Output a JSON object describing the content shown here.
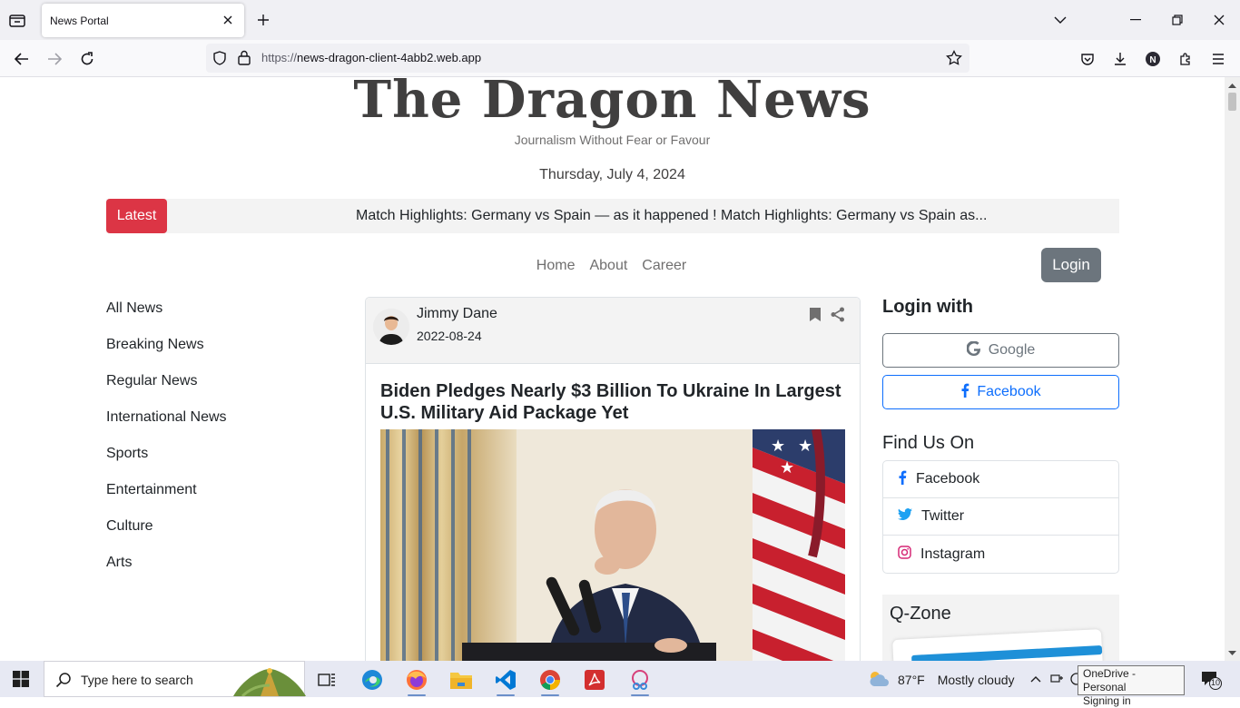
{
  "browser": {
    "tab_title": "News Portal",
    "url_host": "https://news-dragon-client-4abb2.web.app",
    "url_scheme_dim": "https://",
    "url_rest": "news-dragon-client-4abb2.web.app"
  },
  "site": {
    "logo": "The Dragon News",
    "tagline": "Journalism Without Fear or Favour",
    "date": "Thursday, July 4, 2024",
    "latest_label": "Latest",
    "ticker_text": "Match Highlights: Germany vs Spain — as it happened ! Match Highlights: Germany vs Spain as..."
  },
  "nav": {
    "items": [
      "Home",
      "About",
      "Career"
    ],
    "login": "Login"
  },
  "categories": [
    "All News",
    "Breaking News",
    "Regular News",
    "International News",
    "Sports",
    "Entertainment",
    "Culture",
    "Arts"
  ],
  "article": {
    "author": "Jimmy Dane",
    "date": "2022-08-24",
    "title": "Biden Pledges Nearly $3 Billion To Ukraine In Largest U.S. Military Aid Package Yet"
  },
  "sidebar": {
    "login_with": "Login with",
    "google": "Google",
    "facebook": "Facebook",
    "find_us": "Find Us On",
    "socials": [
      "Facebook",
      "Twitter",
      "Instagram"
    ],
    "qzone": "Q-Zone"
  },
  "taskbar": {
    "search_placeholder": "Type here to search",
    "temperature": "87°F",
    "weather": "Mostly cloudy",
    "tooltip_line1": "OneDrive - Personal",
    "tooltip_line2": "Signing in",
    "notification_count": "10"
  },
  "colors": {
    "accent_red": "#dc3545",
    "login_gray": "#6c757d",
    "facebook_blue": "#0d6efd"
  }
}
